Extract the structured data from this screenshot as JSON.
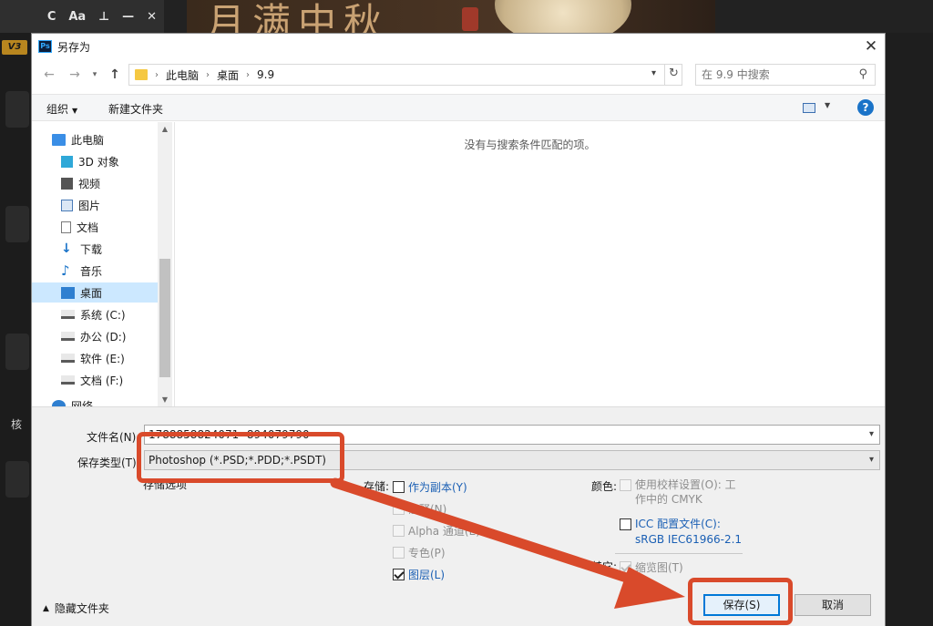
{
  "background": {
    "toolbar_icons": [
      "C",
      "Aa",
      "⊥",
      "—",
      "✕"
    ],
    "version_badge": "V3",
    "banner_text": "月满中秋",
    "left_hint": "核"
  },
  "dialog": {
    "app_icon_text": "Ps",
    "title": "另存为",
    "close_glyph": "✕",
    "address": {
      "crumbs": [
        "此电脑",
        "桌面",
        "9.9"
      ]
    },
    "search": {
      "placeholder": "在 9.9 中搜索"
    },
    "toolbar": {
      "organize": "组织",
      "new_folder": "新建文件夹",
      "help": "?"
    },
    "tree": [
      {
        "label": "此电脑",
        "icon": "computer-icon",
        "color": "#3a8ee6"
      },
      {
        "label": "3D 对象",
        "icon": "cube-icon",
        "color": "#2fa8d8"
      },
      {
        "label": "视频",
        "icon": "film-icon",
        "color": "#555555"
      },
      {
        "label": "图片",
        "icon": "picture-icon",
        "color": "#4a7bb7"
      },
      {
        "label": "文档",
        "icon": "document-icon",
        "color": "#7a7a7a"
      },
      {
        "label": "下载",
        "icon": "download-icon",
        "color": "#1a73c8"
      },
      {
        "label": "音乐",
        "icon": "music-icon",
        "color": "#1a73c8"
      },
      {
        "label": "桌面",
        "icon": "desktop-icon",
        "color": "#2f7fd0"
      },
      {
        "label": "系统 (C:)",
        "icon": "drive-icon",
        "color": "#5a5a5a"
      },
      {
        "label": "办公 (D:)",
        "icon": "drive-icon",
        "color": "#5a5a5a"
      },
      {
        "label": "软件 (E:)",
        "icon": "drive-icon",
        "color": "#5a5a5a"
      },
      {
        "label": "文档 (F:)",
        "icon": "drive-icon",
        "color": "#5a5a5a"
      },
      {
        "label": "网络",
        "icon": "network-icon",
        "color": "#2f7fd0"
      }
    ],
    "empty_message": "没有与搜索条件匹配的项。",
    "filename_label": "文件名(N):",
    "filename_value": "1788858824071--894079790",
    "filetype_label": "保存类型(T):",
    "filetype_value": "Photoshop (*.PSD;*.PDD;*.PSDT)",
    "save_options_label": "存储选项",
    "storage_label": "存储:",
    "storage_options": [
      {
        "label": "作为副本(Y)",
        "checked": false,
        "enabled": true
      },
      {
        "label": "注释(N)",
        "checked": false,
        "enabled": false
      },
      {
        "label": "Alpha 通道(E)",
        "checked": false,
        "enabled": false
      },
      {
        "label": "专色(P)",
        "checked": false,
        "enabled": false
      },
      {
        "label": "图层(L)",
        "checked": true,
        "enabled": true
      }
    ],
    "color_label": "颜色:",
    "proof_setup_line1": "使用校样设置(O): 工",
    "proof_setup_line2": "作中的 CMYK",
    "icc_line1": "ICC 配置文件(C):",
    "icc_line2": "sRGB IEC61966-2.1",
    "other_label": "其它:",
    "thumbnail_label": "缩览图(T)",
    "hide_folders": "隐藏文件夹",
    "save_button": "保存(S)",
    "cancel_button": "取消"
  },
  "colors": {
    "annotation": "#d94a2b",
    "accent": "#0078d7",
    "link": "#1a5fb4"
  }
}
